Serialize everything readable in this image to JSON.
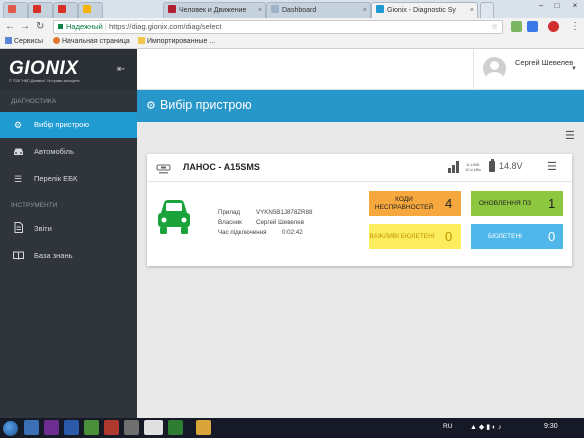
{
  "browser": {
    "tabs": [
      {
        "label": "",
        "color": "#e15b4d"
      },
      {
        "label": "",
        "color": "#d93025"
      },
      {
        "label": "",
        "color": "#d93025"
      },
      {
        "label": "",
        "color": "#f4b400"
      },
      {
        "label": "Человек и Движение",
        "color": "#b01f2f"
      },
      {
        "label": "Dashboard",
        "color": "#9fb3c8"
      },
      {
        "label": "Gionix - Diagnostic Sy",
        "color": "#1f9bd1"
      }
    ],
    "secure_label": "Надежный",
    "url": "https://diag.gionix.com/diag/select",
    "bookmarks": [
      "Сервисы",
      "Начальная страница",
      "Импортированные ..."
    ]
  },
  "sidebar": {
    "logo": "GIONIX",
    "logo_sub": "© ТОВ \"НВП Дінамікс\" Усі права захищено",
    "section_diag": "ДІАГНОСТИКА",
    "section_tools": "ІНСТРУМЕНТИ",
    "items": [
      {
        "label": "Вибір пристрою",
        "icon": "gear-icon",
        "active": true
      },
      {
        "label": "Автомобіль",
        "icon": "car-icon"
      },
      {
        "label": "Перелік ЕБК",
        "icon": "list-icon"
      },
      {
        "label": "Звіти",
        "icon": "document-icon"
      },
      {
        "label": "База знань",
        "icon": "book-icon"
      }
    ]
  },
  "user": {
    "name": "Сергей Шевелев"
  },
  "page": {
    "title": "Вибір пристрою"
  },
  "vehicle": {
    "title": "ЛАНОС - A15SMS",
    "connection": "K-LINE",
    "baud": "10,4 кб/с",
    "voltage": "14.8V",
    "device_label": "Прилад",
    "device_value": "VYKN5B1J878ZR88",
    "owner_label": "Власник",
    "owner_value": "Сергей Шевелев",
    "time_label": "Час підключення",
    "time_value": "0:02:42"
  },
  "tiles": {
    "faults_label": "КОДИ НЕСПРАВНОСТЕЙ",
    "faults_value": "4",
    "updates_label": "ОНОВЛЕННЯ ПЗ",
    "updates_value": "1",
    "important_label": "ВАЖЛИВІ БЮЛЕТЕНІ",
    "important_value": "0",
    "bulletins_label": "БЮЛЕТЕНІ",
    "bulletins_value": "0"
  },
  "taskbar": {
    "lang": "RU",
    "time": "9:30"
  },
  "colors": {
    "accent": "#1f9bd1",
    "sidebar": "#2f353b",
    "car": "#1aa33a"
  }
}
